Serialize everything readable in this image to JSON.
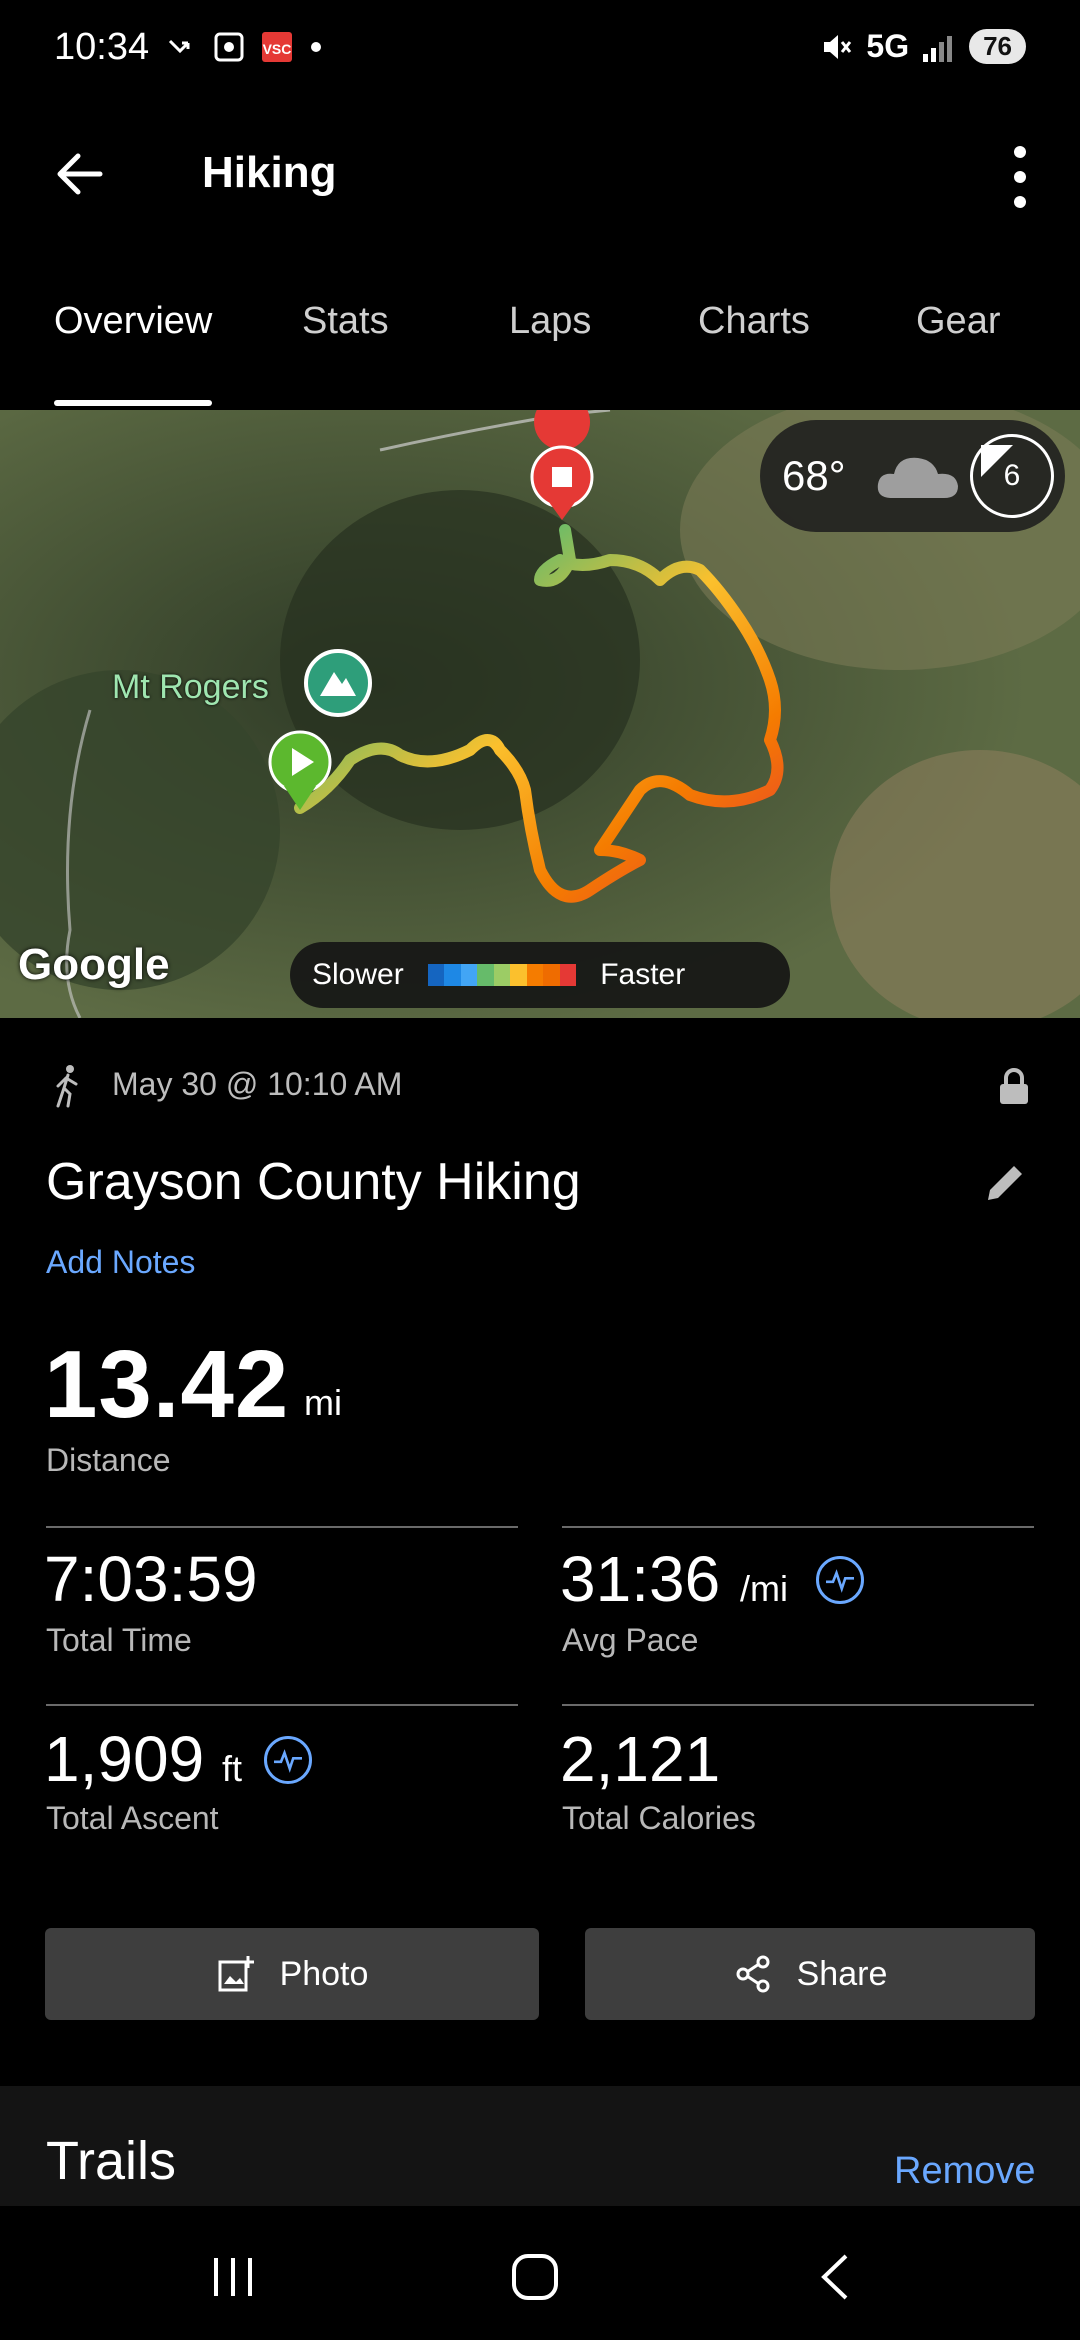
{
  "status_bar": {
    "time": "10:34",
    "network": "5G",
    "battery": "76"
  },
  "app_bar": {
    "title": "Hiking"
  },
  "tabs": [
    {
      "label": "Overview",
      "active": true
    },
    {
      "label": "Stats",
      "active": false
    },
    {
      "label": "Laps",
      "active": false
    },
    {
      "label": "Charts",
      "active": false
    },
    {
      "label": "Gear",
      "active": false
    }
  ],
  "map": {
    "place_label": "Mt Rogers",
    "weather_temp": "68°",
    "wind_value": "6",
    "attribution": "Google",
    "legend_slower": "Slower",
    "legend_faster": "Faster",
    "legend_colors": [
      "#1565c0",
      "#1e88e5",
      "#42a5f5",
      "#66bb6a",
      "#9ccc65",
      "#fbc02d",
      "#f57c00",
      "#e53935"
    ]
  },
  "activity": {
    "datetime": "May 30 @ 10:10 AM",
    "title": "Grayson County Hiking",
    "add_notes": "Add Notes",
    "distance_value": "13.42",
    "distance_unit": "mi",
    "distance_label": "Distance"
  },
  "stats": {
    "total_time": {
      "value": "7:03:59",
      "label": "Total Time"
    },
    "avg_pace": {
      "value": "31:36",
      "unit": "/mi",
      "label": "Avg Pace"
    },
    "total_ascent": {
      "value": "1,909",
      "unit": "ft",
      "label": "Total Ascent"
    },
    "total_calories": {
      "value": "2,121",
      "label": "Total Calories"
    }
  },
  "actions": {
    "photo": "Photo",
    "share": "Share"
  },
  "trails": {
    "title": "Trails",
    "remove": "Remove"
  }
}
